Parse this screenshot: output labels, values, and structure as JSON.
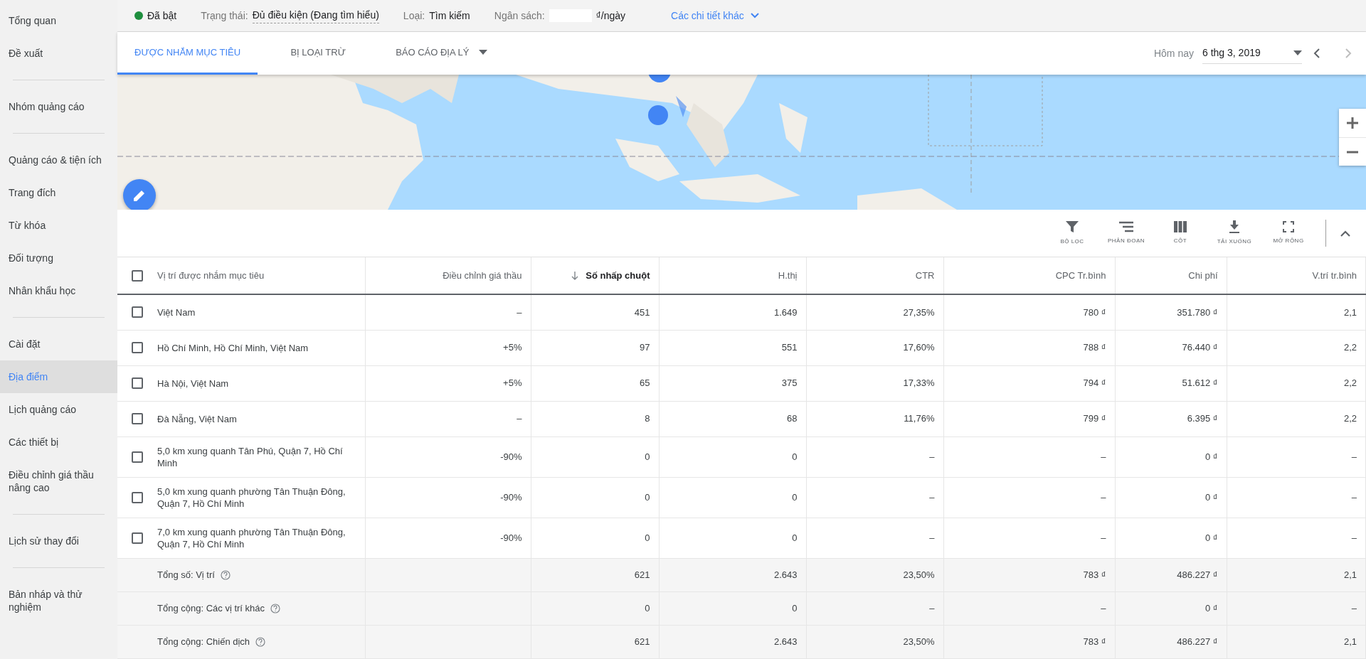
{
  "sidebar": {
    "sections": [
      [
        {
          "label": "Tổng quan",
          "selected": false
        },
        {
          "label": "Đề xuất",
          "selected": false
        }
      ],
      [
        {
          "label": "Nhóm quảng cáo",
          "selected": false
        }
      ],
      [
        {
          "label": "Quảng cáo & tiện ích",
          "selected": false
        },
        {
          "label": "Trang đích",
          "selected": false
        },
        {
          "label": "Từ khóa",
          "selected": false
        },
        {
          "label": "Đối tượng",
          "selected": false
        },
        {
          "label": "Nhân khẩu học",
          "selected": false
        }
      ],
      [
        {
          "label": "Cài đặt",
          "selected": false
        },
        {
          "label": "Địa điểm",
          "selected": true
        },
        {
          "label": "Lịch quảng cáo",
          "selected": false
        },
        {
          "label": "Các thiết bị",
          "selected": false
        },
        {
          "label": "Điều chỉnh giá thầu nâng cao",
          "selected": false
        }
      ],
      [
        {
          "label": "Lịch sử thay đổi",
          "selected": false
        }
      ],
      [
        {
          "label": "Bản nháp và thử nghiệm",
          "selected": false
        }
      ]
    ]
  },
  "summary": {
    "status": {
      "label": "Đã bật",
      "color": "#1e8e3e"
    },
    "state_label": "Trạng thái:",
    "state_value": "Đủ điều kiện (Đang tìm hiểu)",
    "type_label": "Loại:",
    "type_value": "Tìm kiếm",
    "budget_label": "Ngân sách:",
    "budget_unit": "₫/ngày",
    "more_link": "Các chi tiết khác"
  },
  "tabs": [
    {
      "label": "ĐƯỢC NHẮM MỤC TIÊU",
      "selected": true,
      "dropdown": false
    },
    {
      "label": "BỊ LOẠI TRỪ",
      "selected": false,
      "dropdown": false
    },
    {
      "label": "BÁO CÁO ĐỊA LÝ",
      "selected": false,
      "dropdown": true
    }
  ],
  "date_range": {
    "label": "Hôm nay",
    "value": "6 thg 3, 2019"
  },
  "toolbar": [
    {
      "label": "BỘ LỌC",
      "kind": "filter"
    },
    {
      "label": "PHÂN ĐOẠN",
      "kind": "segment"
    },
    {
      "label": "CỘT",
      "kind": "columns"
    },
    {
      "label": "TẢI XUỐNG",
      "kind": "download"
    },
    {
      "label": "MỞ RỘNG",
      "kind": "expand"
    }
  ],
  "table": {
    "select_all": {
      "checked": false
    },
    "columns": [
      {
        "label": "Vị trí được nhắm mục tiêu",
        "sorted": false
      },
      {
        "label": "Điều chỉnh giá thầu",
        "sorted": false
      },
      {
        "label": "Số nhấp chuột",
        "sorted": true
      },
      {
        "label": "H.thị",
        "sorted": false
      },
      {
        "label": "CTR",
        "sorted": false
      },
      {
        "label": "CPC Tr.bình",
        "sorted": false
      },
      {
        "label": "Chi phí",
        "sorted": false
      },
      {
        "label": "V.trí tr.bình",
        "sorted": false
      }
    ],
    "rows": [
      {
        "checked": false,
        "cells": [
          "Việt Nam",
          "–",
          "451",
          "1.649",
          "27,35%",
          "780 ₫",
          "351.780 ₫",
          "2,1"
        ]
      },
      {
        "checked": false,
        "cells": [
          "Hồ Chí Minh, Hồ Chí Minh, Việt Nam",
          "+5%",
          "97",
          "551",
          "17,60%",
          "788 ₫",
          "76.440 ₫",
          "2,2"
        ]
      },
      {
        "checked": false,
        "cells": [
          "Hà Nội, Việt Nam",
          "+5%",
          "65",
          "375",
          "17,33%",
          "794 ₫",
          "51.612 ₫",
          "2,2"
        ]
      },
      {
        "checked": false,
        "cells": [
          "Đà Nẵng, Việt Nam",
          "–",
          "8",
          "68",
          "11,76%",
          "799 ₫",
          "6.395 ₫",
          "2,2"
        ]
      },
      {
        "checked": false,
        "cells": [
          "5,0 km xung quanh Tân Phú, Quận 7, Hồ Chí Minh",
          "-90%",
          "0",
          "0",
          "–",
          "–",
          "0 ₫",
          "–"
        ]
      },
      {
        "checked": false,
        "cells": [
          "5,0 km xung quanh phường Tân Thuận Đông, Quận 7, Hồ Chí Minh",
          "-90%",
          "0",
          "0",
          "–",
          "–",
          "0 ₫",
          "–"
        ]
      },
      {
        "checked": false,
        "cells": [
          "7,0 km xung quanh phường Tân Thuận Đông, Quận 7, Hồ Chí Minh",
          "-90%",
          "0",
          "0",
          "–",
          "–",
          "0 ₫",
          "–"
        ]
      }
    ],
    "totals": [
      {
        "cells": [
          "Tổng số: Vị trí",
          "",
          "621",
          "2.643",
          "23,50%",
          "783 ₫",
          "486.227 ₫",
          "2,1"
        ]
      },
      {
        "cells": [
          "Tổng cộng: Các vị trí khác",
          "",
          "0",
          "0",
          "–",
          "–",
          "0 ₫",
          "–"
        ]
      },
      {
        "cells": [
          "Tổng cộng: Chiến dịch",
          "",
          "621",
          "2.643",
          "23,50%",
          "783 ₫",
          "486.227 ₫",
          "2,1"
        ]
      }
    ]
  }
}
